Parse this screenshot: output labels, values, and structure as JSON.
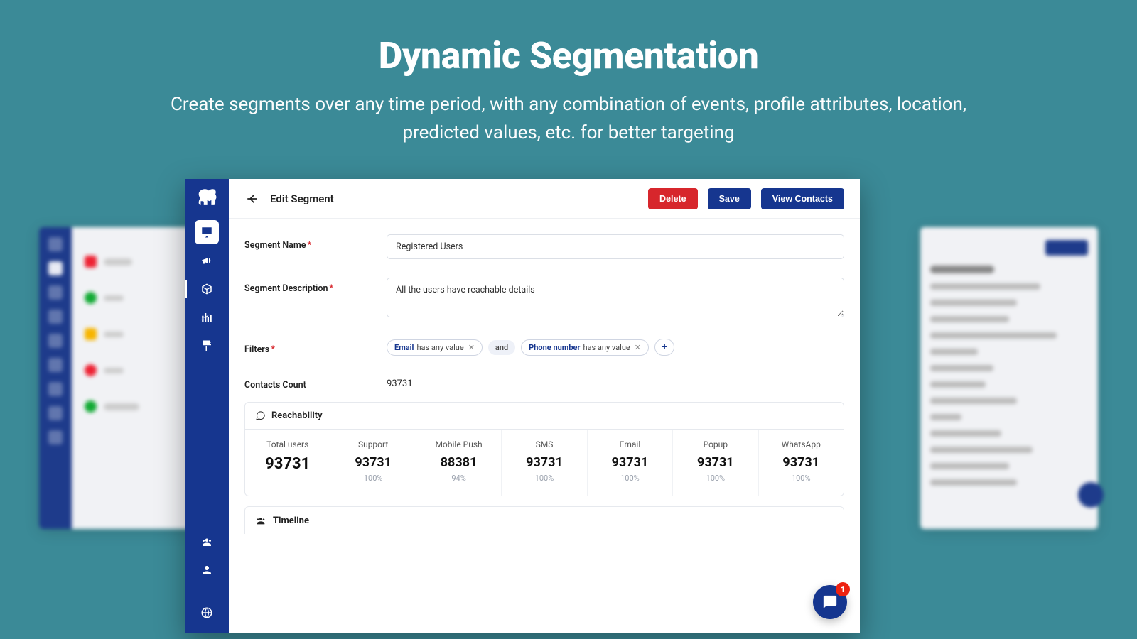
{
  "hero": {
    "title": "Dynamic Segmentation",
    "subtitle": "Create segments over any time period, with any combination of events, profile attributes, location, predicted values, etc. for better targeting"
  },
  "topbar": {
    "title": "Edit Segment",
    "delete": "Delete",
    "save": "Save",
    "view_contacts": "View Contacts"
  },
  "form": {
    "segment_name_label": "Segment Name",
    "segment_name_value": "Registered Users",
    "segment_desc_label": "Segment Description",
    "segment_desc_value": "All the users have reachable details",
    "filters_label": "Filters",
    "contacts_count_label": "Contacts Count",
    "contacts_count_value": "93731"
  },
  "filters": {
    "chip1_field": "Email",
    "chip1_op": "has any value",
    "and": "and",
    "chip2_field": "Phone number",
    "chip2_op": "has any value"
  },
  "reach": {
    "header": "Reachability",
    "total_label": "Total users",
    "total_value": "93731",
    "cols": [
      {
        "label": "Support",
        "value": "93731",
        "pct": "100%"
      },
      {
        "label": "Mobile Push",
        "value": "88381",
        "pct": "94%"
      },
      {
        "label": "SMS",
        "value": "93731",
        "pct": "100%"
      },
      {
        "label": "Email",
        "value": "93731",
        "pct": "100%"
      },
      {
        "label": "Popup",
        "value": "93731",
        "pct": "100%"
      },
      {
        "label": "WhatsApp",
        "value": "93731",
        "pct": "100%"
      }
    ]
  },
  "timeline": {
    "header": "Timeline"
  },
  "chat": {
    "badge": "1"
  }
}
